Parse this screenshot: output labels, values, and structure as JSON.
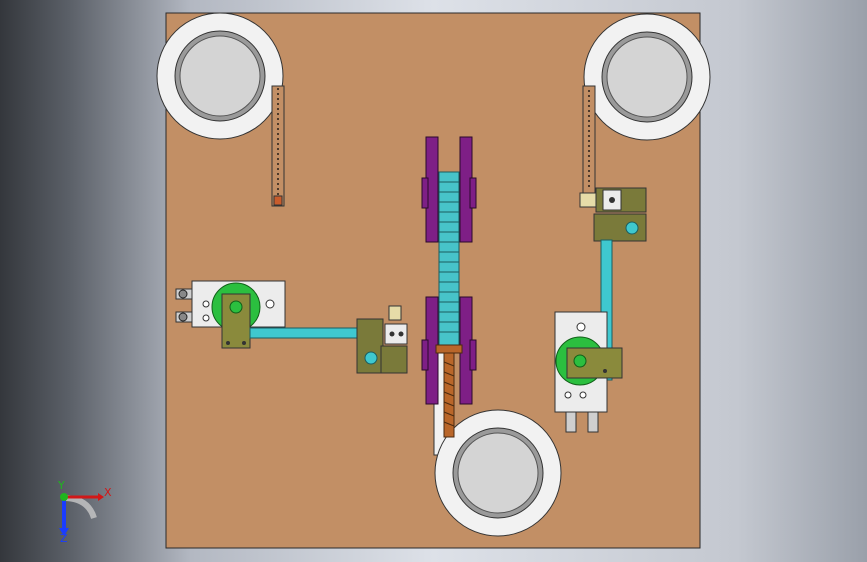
{
  "viewport": {
    "background": "#c9cdd4",
    "plate_color": "#c28f65",
    "cylinder_color": "#3fc8cf",
    "bracket_color": "#7e1f86",
    "rack_color": "#47c3c9",
    "motor_color": "#7a7a3a",
    "disc_color": "#cdcdcd",
    "hub_color": "#2bbf3f",
    "lead_screw_color": "#b9662a"
  },
  "triad": {
    "x_label": "X",
    "y_label": "Y",
    "z_label": "Z",
    "x_color": "#d11818",
    "y_color": "#1fb51f",
    "z_color": "#1a3cff"
  }
}
